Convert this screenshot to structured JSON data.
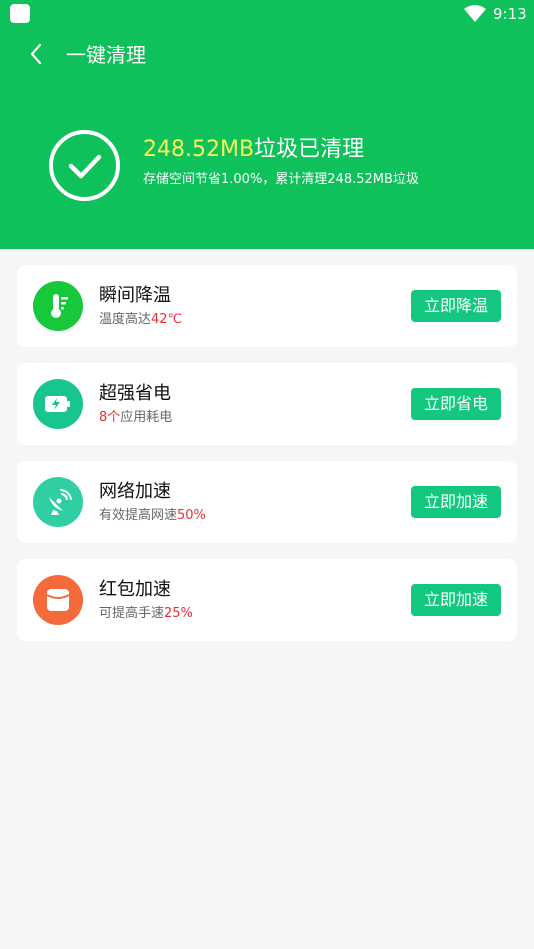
{
  "status_bar": {
    "time": "9:13"
  },
  "header": {
    "title": "一键清理"
  },
  "result": {
    "amount": "248.52MB",
    "suffix": "垃圾已清理",
    "subtitle": "存储空间节省1.00%，累计清理248.52MB垃圾"
  },
  "cards": [
    {
      "title": "瞬间降温",
      "sub_prefix": "温度高达",
      "sub_highlight": "42℃",
      "sub_suffix": "",
      "button": "立即降温",
      "icon": "thermometer-icon",
      "icon_color": "#17c93a"
    },
    {
      "title": "超强省电",
      "sub_prefix": "",
      "sub_highlight": "8个",
      "sub_suffix": "应用耗电",
      "button": "立即省电",
      "icon": "battery-icon",
      "icon_color": "#19c58f"
    },
    {
      "title": "网络加速",
      "sub_prefix": "有效提高网速",
      "sub_highlight": "50%",
      "sub_suffix": "",
      "button": "立即加速",
      "icon": "satellite-icon",
      "icon_color": "#2fcfa3"
    },
    {
      "title": "红包加速",
      "sub_prefix": "可提高手速",
      "sub_highlight": "25%",
      "sub_suffix": "",
      "button": "立即加速",
      "icon": "red-packet-icon",
      "icon_color": "#f46a3b"
    }
  ],
  "colors": {
    "primary": "#0ec15b",
    "button": "#14c77e",
    "highlight": "#e9303a",
    "amount": "#f6f35a"
  }
}
